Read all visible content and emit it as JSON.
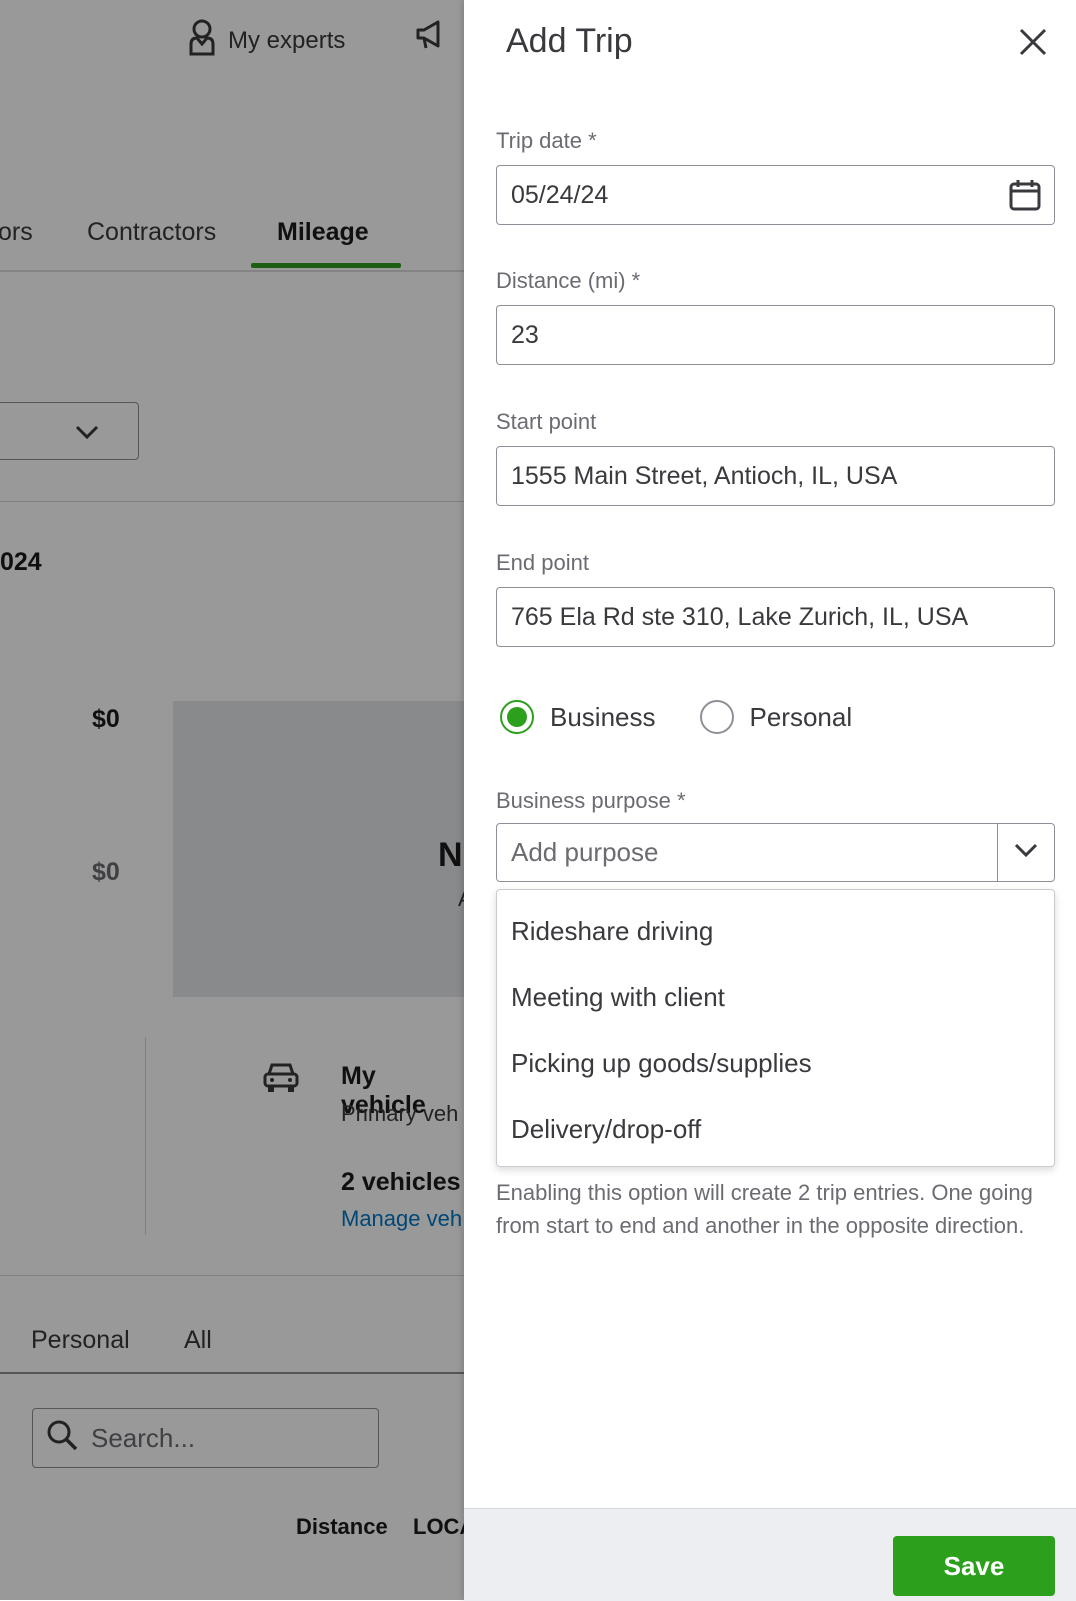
{
  "background": {
    "topbar": {
      "experts_label": "My experts"
    },
    "tabs": [
      {
        "label": "ors"
      },
      {
        "label": "Contractors"
      },
      {
        "label": "Mileage",
        "active": true
      }
    ],
    "year_fragment": "024",
    "chart": {
      "value_top": "$0",
      "value_bottom": "$0",
      "empty_text": "N",
      "empty_sub": "A"
    },
    "vehicles": {
      "title": "My vehicle",
      "subtitle": "Primary veh",
      "count": "2 vehicles",
      "manage_link": "Manage veh"
    },
    "filter_tabs": [
      {
        "label": "Personal"
      },
      {
        "label": "All"
      }
    ],
    "search": {
      "placeholder": "Search..."
    },
    "columns": [
      {
        "label": "Distance"
      },
      {
        "label": "LOCA"
      }
    ]
  },
  "drawer": {
    "title": "Add Trip",
    "trip_date": {
      "label": "Trip date *",
      "value": "05/24/24"
    },
    "distance": {
      "label": "Distance (mi) *",
      "value": "23"
    },
    "start_point": {
      "label": "Start point",
      "value": "1555 Main Street, Antioch, IL, USA"
    },
    "end_point": {
      "label": "End point",
      "value": "765 Ela Rd ste 310, Lake Zurich, IL, USA"
    },
    "trip_type": {
      "options": [
        "Business",
        "Personal"
      ],
      "selected": "Business"
    },
    "business_purpose": {
      "label": "Business purpose *",
      "placeholder": "Add purpose",
      "options": [
        "Rideshare driving",
        "Meeting with client",
        "Picking up goods/supplies",
        "Delivery/drop-off"
      ]
    },
    "helper_text": "Enabling this option will create 2 trip entries. One going from start to end and another in the opposite direction.",
    "save_label": "Save"
  },
  "colors": {
    "accent": "#2ca01c",
    "link": "#0077c5",
    "overlay": "rgba(0,0,0,0.4)"
  }
}
